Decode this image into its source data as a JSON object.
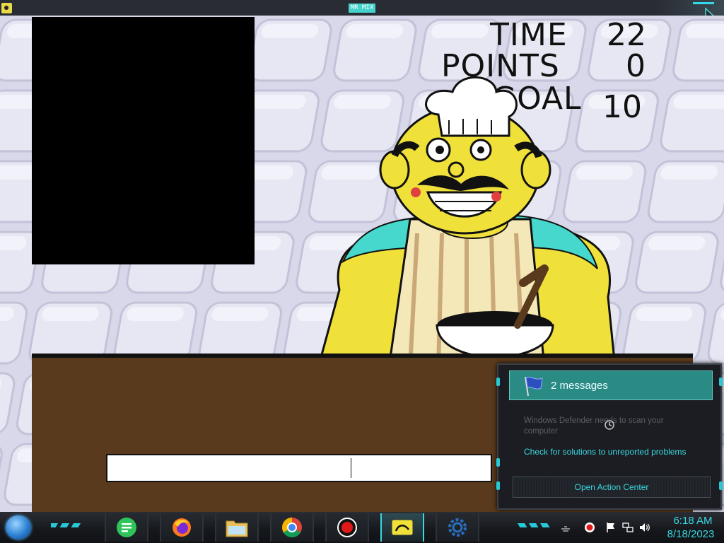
{
  "window": {
    "title": "MR MIX",
    "app_icon": "game-icon"
  },
  "hud": {
    "time_label": "TIME",
    "time_value": "22",
    "points_label": "POINTS",
    "points_value": "0",
    "goal_label": "GOAL",
    "goal_value": "10"
  },
  "input": {
    "value": ""
  },
  "notification": {
    "title": "2 messages",
    "message1": "Windows Defender needs to scan your computer",
    "message2": "Check for solutions to unreported problems",
    "action_label": "Open Action Center",
    "icon": "flag-icon"
  },
  "taskbar": {
    "apps": [
      {
        "name": "notes",
        "icon": "note-icon"
      },
      {
        "name": "firefox",
        "icon": "firefox-icon"
      },
      {
        "name": "file-explorer",
        "icon": "folder-icon"
      },
      {
        "name": "chrome",
        "icon": "chrome-icon"
      },
      {
        "name": "recorder",
        "icon": "record-icon"
      },
      {
        "name": "game",
        "icon": "game-icon"
      },
      {
        "name": "settings",
        "icon": "gear-icon"
      }
    ],
    "clock": {
      "time": "6:18 AM",
      "date": "8/18/2023"
    }
  },
  "colors": {
    "accent": "#3ad8e0",
    "counter": "#5a3a1c",
    "chef_skin": "#f0e03a",
    "chef_shirt": "#46d8cc"
  }
}
